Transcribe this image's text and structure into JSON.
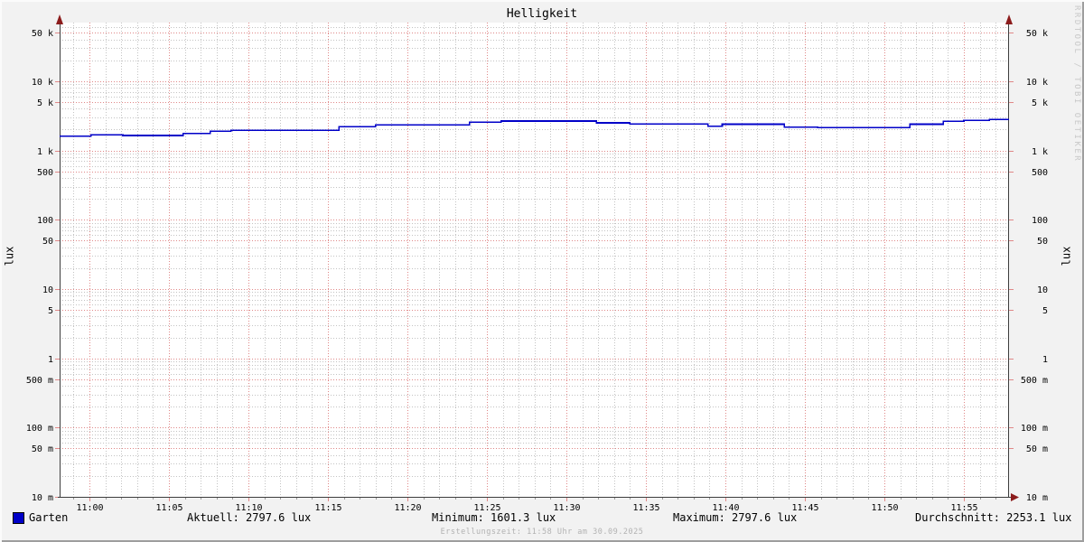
{
  "title": "Helligkeit",
  "watermark": "RRDTOOL / TOBI OETIKER",
  "axis": {
    "left_unit": "lux",
    "right_unit": "lux"
  },
  "legend": {
    "series_label": "Garten",
    "series_color": "#0000c8"
  },
  "footer": {
    "stats": [
      "Aktuell: 2797.6 lux",
      "Minimum: 1601.3 lux",
      "Maximum: 2797.6 lux",
      "Durchschnitt: 2253.1 lux"
    ]
  },
  "creation_line": "Erstellungszeit: 11:58 Uhr am 30.09.2025",
  "chart_data": {
    "type": "line",
    "style": "step",
    "y_scale": "log",
    "title": "Helligkeit",
    "ylabel": "lux",
    "xlabel": "",
    "x_range_time": [
      "10:58",
      "11:58"
    ],
    "ylim": [
      0.01,
      70000
    ],
    "grid": "on",
    "legend_position": "bottom-left",
    "y_ticks": [
      {
        "v": 50000,
        "label": "50 k"
      },
      {
        "v": 10000,
        "label": "10 k"
      },
      {
        "v": 5000,
        "label": "5 k"
      },
      {
        "v": 1000,
        "label": "1 k"
      },
      {
        "v": 500,
        "label": "500"
      },
      {
        "v": 100,
        "label": "100"
      },
      {
        "v": 50,
        "label": "50"
      },
      {
        "v": 10,
        "label": "10"
      },
      {
        "v": 5,
        "label": "5"
      },
      {
        "v": 1,
        "label": "1"
      },
      {
        "v": 0.5,
        "label": "500 m"
      },
      {
        "v": 0.1,
        "label": "100 m"
      },
      {
        "v": 0.05,
        "label": "50 m"
      },
      {
        "v": 0.01,
        "label": "10 m"
      }
    ],
    "x_ticks": [
      {
        "t": 0,
        "label": "11:00"
      },
      {
        "t": 5,
        "label": "11:05"
      },
      {
        "t": 10,
        "label": "11:10"
      },
      {
        "t": 15,
        "label": "11:15"
      },
      {
        "t": 20,
        "label": "11:20"
      },
      {
        "t": 25,
        "label": "11:25"
      },
      {
        "t": 30,
        "label": "11:30"
      },
      {
        "t": 35,
        "label": "11:35"
      },
      {
        "t": 40,
        "label": "11:40"
      },
      {
        "t": 45,
        "label": "11:45"
      },
      {
        "t": 50,
        "label": "11:50"
      },
      {
        "t": 55,
        "label": "11:55"
      }
    ],
    "minor_x_every_minutes": 1,
    "series": [
      {
        "name": "Garten",
        "color": "#0000c8",
        "unit": "lux",
        "points_t_min_after_1100_v_lux": [
          [
            -1.9,
            1601.3
          ],
          [
            0.1,
            1680
          ],
          [
            2.1,
            1640
          ],
          [
            5.9,
            1750
          ],
          [
            7.6,
            1890
          ],
          [
            8.9,
            1960
          ],
          [
            15.7,
            2200
          ],
          [
            18.0,
            2330
          ],
          [
            23.9,
            2570
          ],
          [
            25.9,
            2650
          ],
          [
            31.9,
            2500
          ],
          [
            34.0,
            2400
          ],
          [
            38.9,
            2220
          ],
          [
            39.8,
            2390
          ],
          [
            43.7,
            2160
          ],
          [
            45.8,
            2130
          ],
          [
            51.6,
            2390
          ],
          [
            53.7,
            2620
          ],
          [
            55.0,
            2700
          ],
          [
            56.6,
            2797.6
          ]
        ]
      }
    ],
    "stats": {
      "aktuell_lux": 2797.6,
      "minimum_lux": 1601.3,
      "maximum_lux": 2797.6,
      "durchschnitt_lux": 2253.1
    },
    "colors": {
      "background": "#f2f2f2",
      "canvas": "#ffffff",
      "major_grid": "#e08888",
      "minor_grid": "#c3c3c3",
      "axis": "#3d3d3d",
      "arrow": "#8c1c1c",
      "line": "#0000c8"
    }
  }
}
